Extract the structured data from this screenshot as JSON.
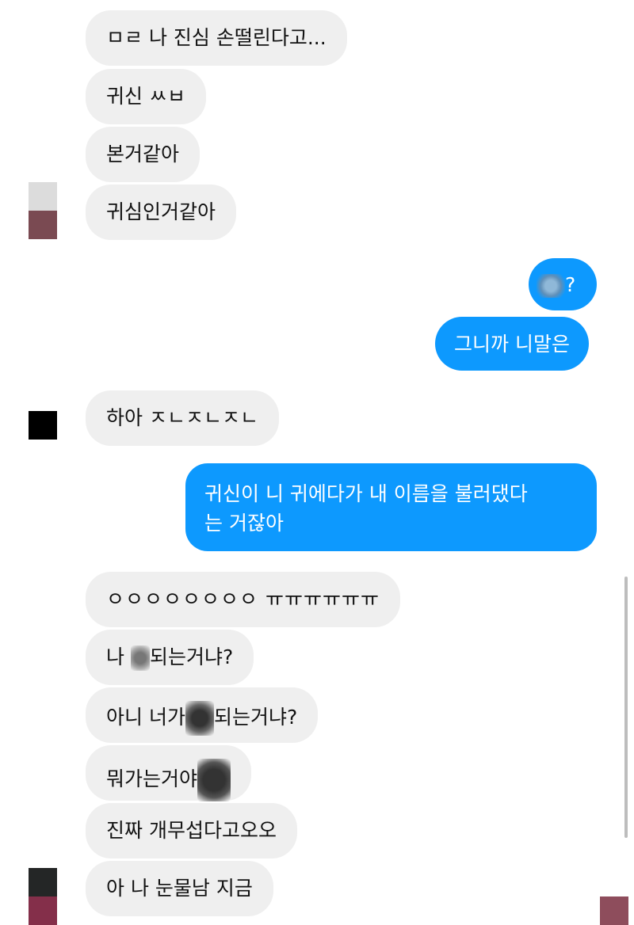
{
  "conversation": {
    "received": [
      {
        "text": "ㅁㄹ 나 진심 손떨린다고..."
      },
      {
        "text": "귀신 ㅆㅂ"
      },
      {
        "text": "본거같아"
      },
      {
        "text": "귀심인거같아"
      },
      {
        "text": "하아 ㅈㄴㅈㄴㅈㄴ"
      },
      {
        "text": "ㅇㅇㅇㅇㅇㅇㅇㅇ ㅠㅠㅠㅠㅠㅠ"
      },
      {
        "before": "나 ",
        "after": "되는거냐?"
      },
      {
        "before": "아니 너가",
        "after": "되는거냐?"
      },
      {
        "before": "뭐가는거야",
        "after": ""
      },
      {
        "text": "진짜 개무섭다고오오"
      },
      {
        "text": "아 나 눈물남 지금"
      }
    ],
    "sent": [
      {
        "before": "",
        "after": "?"
      },
      {
        "text": "그니까 니말은"
      },
      {
        "line1": "귀신이 니 귀에다가 내 이름을 불러댔다",
        "line2": "는 거잖아"
      }
    ]
  },
  "colors": {
    "received_bubble": "#efefef",
    "sent_bubble": "#0d99fe",
    "sent_text": "#ffffff",
    "received_text": "#111111"
  },
  "icons": {
    "censor": "scribble-censor-icon",
    "avatar": "user-avatar-icon"
  }
}
